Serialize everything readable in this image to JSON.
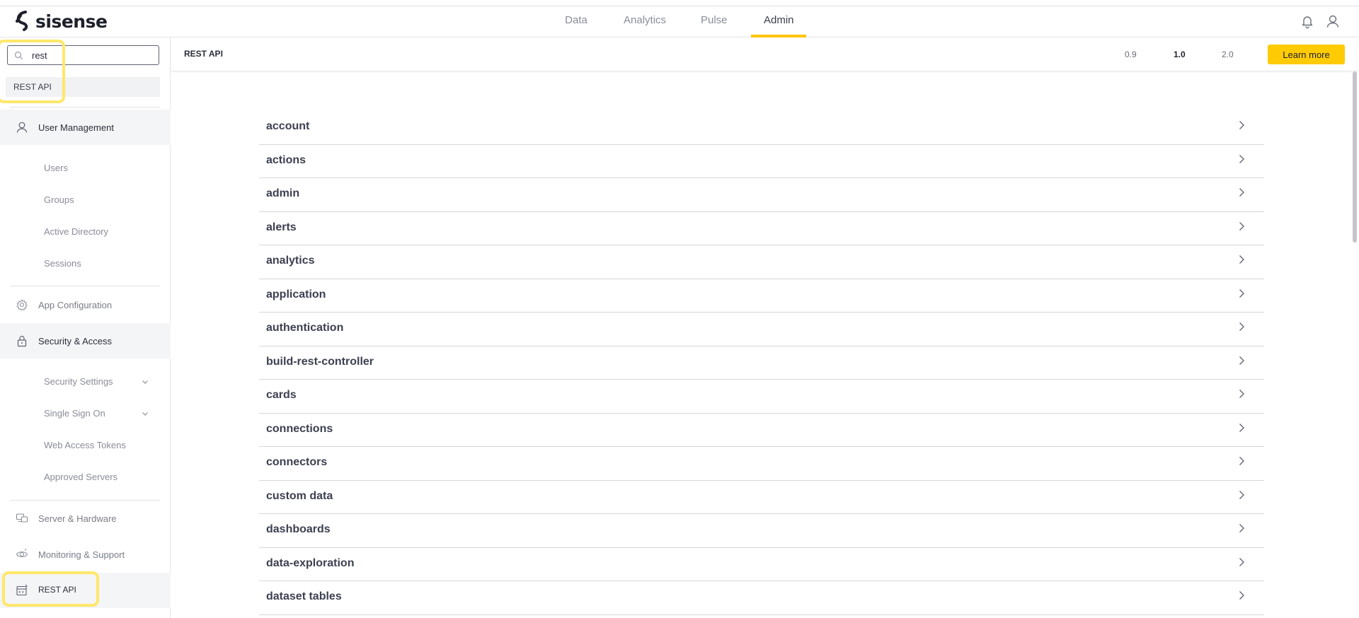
{
  "app": {
    "logo_text": "sisense"
  },
  "topnav": {
    "tabs": [
      {
        "label": "Data"
      },
      {
        "label": "Analytics"
      },
      {
        "label": "Pulse"
      },
      {
        "label": "Admin"
      }
    ],
    "active_tab": "Admin",
    "accent_color": "#ffc600"
  },
  "top_icons": [
    "bell-icon",
    "user-icon"
  ],
  "sidebar": {
    "search": {
      "value": "rest",
      "placeholder": ""
    },
    "search_result": "REST API",
    "sections": {
      "user_management": "User Management",
      "users": "Users",
      "groups": "Groups",
      "active_directory": "Active Directory",
      "sessions": "Sessions",
      "app_configuration": "App Configuration",
      "security_access": "Security & Access",
      "security_settings": "Security Settings",
      "single_sign_on": "Single Sign On",
      "web_access_tokens": "Web Access Tokens",
      "approved_servers": "Approved Servers",
      "server_hardware": "Server & Hardware",
      "monitoring_support": "Monitoring & Support",
      "rest_api": "REST API"
    },
    "highlight_color": "#ffe76b"
  },
  "header": {
    "title": "REST API",
    "versions": [
      "0.9",
      "1.0",
      "2.0"
    ],
    "active_version": "1.0",
    "learn_more": "Learn more",
    "button_color": "#ffcb05"
  },
  "api_groups": [
    "account",
    "actions",
    "admin",
    "alerts",
    "analytics",
    "application",
    "authentication",
    "build-rest-controller",
    "cards",
    "connections",
    "connectors",
    "custom data",
    "dashboards",
    "data-exploration",
    "dataset tables"
  ]
}
